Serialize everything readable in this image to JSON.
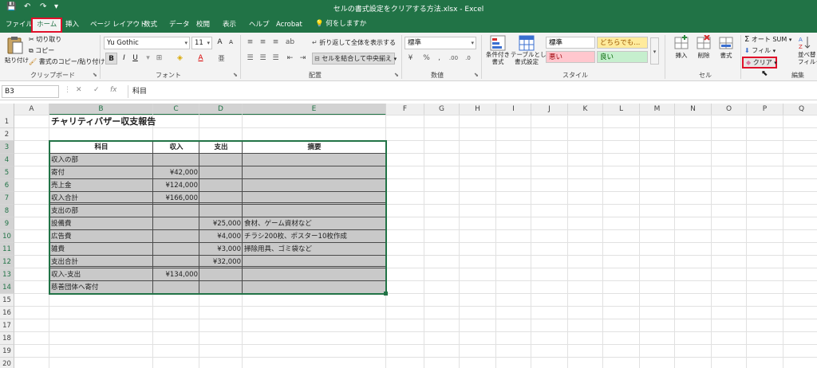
{
  "window": {
    "title": "セルの書式設定をクリアする方法.xlsx  -  Excel",
    "quick_access": [
      "💾",
      "↶",
      "↷",
      "▾"
    ]
  },
  "tabs": [
    "ファイル",
    "ホーム",
    "挿入",
    "ページ レイアウト",
    "数式",
    "データ",
    "校閲",
    "表示",
    "ヘルプ",
    "Acrobat"
  ],
  "tell_me": "何をしますか",
  "ribbon": {
    "clipboard": {
      "paste": "貼り付け",
      "cut": "切り取り",
      "copy": "コピー",
      "copy_format": "書式のコピー/貼り付け",
      "label": "クリップボード"
    },
    "font": {
      "name": "Yu Gothic",
      "size": "11",
      "label": "フォント",
      "bold": "B",
      "italic": "I",
      "underline": "U",
      "grow": "A",
      "shrink": "A"
    },
    "alignment": {
      "wrap": "折り返して全体を表示する",
      "merge": "セルを結合して中央揃え",
      "label": "配置"
    },
    "number": {
      "format": "標準",
      "label": "数値"
    },
    "styles": {
      "conditional": [
        "条件付き",
        "書式"
      ],
      "table": [
        "テーブルとして",
        "書式設定"
      ],
      "cells": [
        {
          "text": "標準",
          "bg": "#ffffff",
          "color": "#000000"
        },
        {
          "text": "どちらでも...",
          "bg": "#ffeb9c",
          "color": "#9c5700"
        },
        {
          "text": "悪い",
          "bg": "#ffc7ce",
          "color": "#9c0006"
        },
        {
          "text": "良い",
          "bg": "#c6efce",
          "color": "#006100"
        }
      ],
      "label": "スタイル"
    },
    "cells_group": {
      "insert": "挿入",
      "delete": "削除",
      "format": "書式",
      "label": "セル"
    },
    "editing": {
      "autosum": "オート SUM",
      "fill": "フィル",
      "clear": "クリア",
      "sort": [
        "並べ替",
        "フィルタ"
      ],
      "label": "編集"
    }
  },
  "formula_bar": {
    "name_box": "B3",
    "fx": "fx",
    "cancel": "✕",
    "enter": "✓",
    "content": "科目"
  },
  "grid": {
    "columns": [
      "A",
      "B",
      "C",
      "D",
      "E",
      "F",
      "G",
      "H",
      "I",
      "J",
      "K",
      "L",
      "M",
      "N",
      "O",
      "P",
      "Q"
    ],
    "rows": [
      "1",
      "2",
      "3",
      "4",
      "5",
      "6",
      "7",
      "8",
      "9",
      "10",
      "11",
      "12",
      "13",
      "14",
      "15",
      "16",
      "17",
      "18",
      "19",
      "20"
    ],
    "title": "チャリティバザー収支報告",
    "headers": [
      "科目",
      "収入",
      "支出",
      "摘要"
    ],
    "data": [
      [
        "収入の部",
        "",
        "",
        ""
      ],
      [
        "寄付",
        "¥42,000",
        "",
        ""
      ],
      [
        "売上金",
        "¥124,000",
        "",
        ""
      ],
      [
        "収入合計",
        "¥166,000",
        "",
        ""
      ],
      [
        "支出の部",
        "",
        "",
        ""
      ],
      [
        "設備費",
        "",
        "¥25,000",
        "食材、ゲーム資材など"
      ],
      [
        "広告費",
        "",
        "¥4,000",
        "チラシ200枚、ポスター10枚作成"
      ],
      [
        "雑費",
        "",
        "¥3,000",
        "掃除用具、ゴミ袋など"
      ],
      [
        "支出合計",
        "",
        "¥32,000",
        ""
      ],
      [
        "収入-支出",
        "¥134,000",
        "",
        ""
      ],
      [
        "慈善団体へ寄付",
        "",
        "",
        ""
      ]
    ]
  },
  "colors": {
    "accent": "#217346",
    "highlight": "#e0102a",
    "table_fill": "#c9c9c9"
  }
}
